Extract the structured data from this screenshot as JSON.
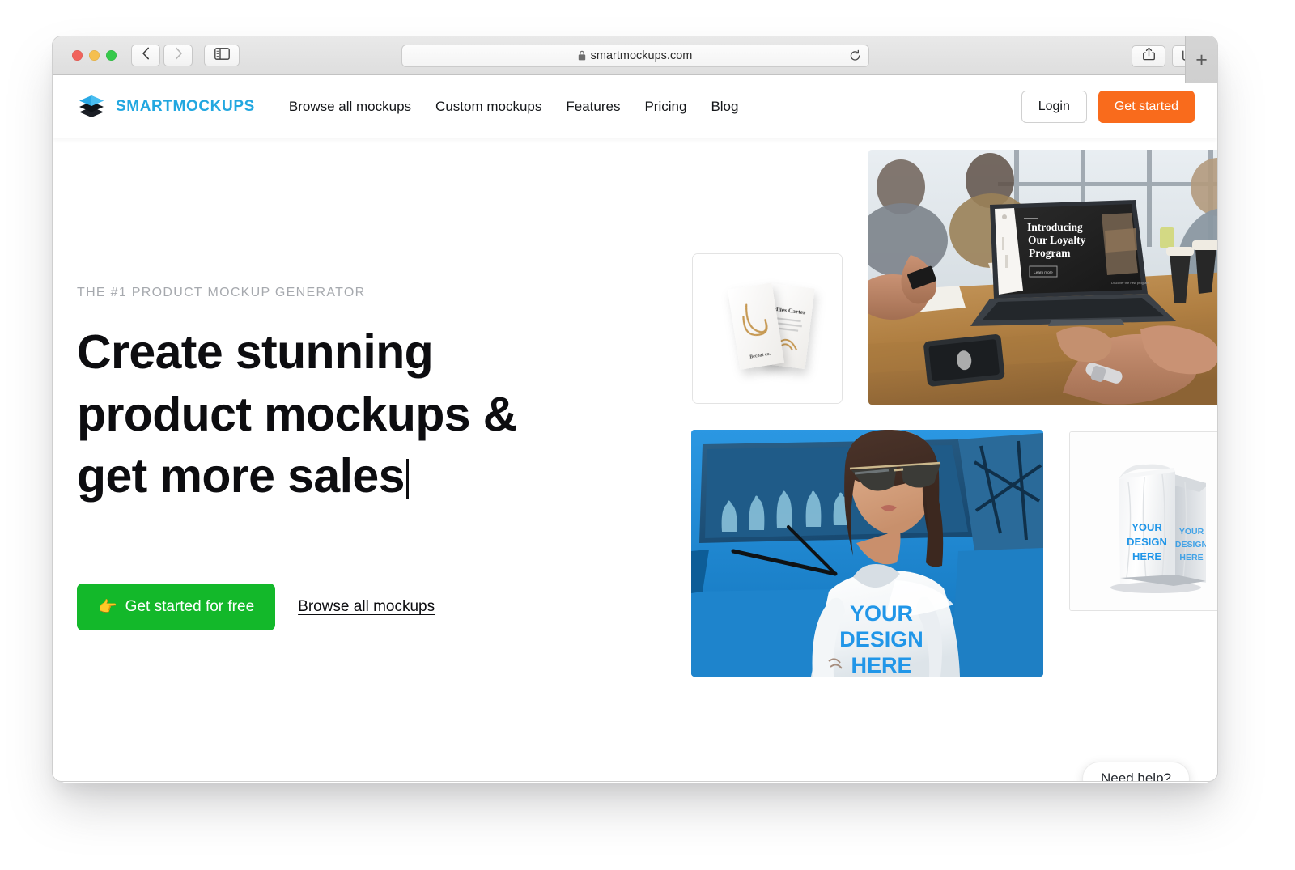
{
  "browser": {
    "url": "smartmockups.com",
    "lock_icon": "lock-icon",
    "reload_icon": "reload-icon",
    "back_icon": "chevron-left-icon",
    "forward_icon": "chevron-right-icon",
    "sidebar_icon": "sidebar-toggle-icon",
    "share_icon": "share-icon",
    "tabs_icon": "show-all-tabs-icon",
    "new_tab_label": "+",
    "traffic_lights": {
      "close": "close-window-button",
      "minimize": "minimize-window-button",
      "zoom": "zoom-window-button"
    }
  },
  "site_header": {
    "logo_text": "SMARTMOCKUPS",
    "logo_icon": "stacked-layers-icon",
    "nav_items": [
      {
        "label": "Browse all mockups"
      },
      {
        "label": "Custom mockups"
      },
      {
        "label": "Features"
      },
      {
        "label": "Pricing"
      },
      {
        "label": "Blog"
      }
    ],
    "login_label": "Login",
    "get_started_label": "Get started"
  },
  "hero": {
    "eyebrow": "THE #1 PRODUCT MOCKUP GENERATOR",
    "headline_line1": "Create stunning",
    "headline_line2": "product mockups &",
    "headline_line3": "get more sales",
    "primary_cta": "Get started for free",
    "primary_cta_emoji": "👉",
    "secondary_cta": "Browse all mockups"
  },
  "mockups": {
    "business_cards": {
      "name": "business-cards-mockup",
      "card_title": "Miles Carter",
      "card_footer": "Becoat co."
    },
    "laptop_meeting": {
      "name": "laptop-meeting-mockup",
      "screen_line1": "Introducing",
      "screen_line2": "Our Loyalty",
      "screen_line3": "Program",
      "screen_button": "Learn more"
    },
    "tshirt": {
      "name": "tshirt-mockup",
      "design_line1": "YOUR",
      "design_line2": "DESIGN",
      "design_line3": "HERE"
    },
    "package": {
      "name": "package-bag-mockup",
      "design_line1": "YOUR",
      "design_line2": "DESIGN",
      "design_line3": "HERE"
    }
  },
  "support": {
    "need_help_label": "Need help?"
  },
  "colors": {
    "brand_blue": "#22a7e0",
    "cta_orange": "#f96b1c",
    "cta_green": "#13b82a",
    "design_blue": "#2196e8",
    "text_dark": "#0d0d10",
    "eyebrow_gray": "#a6a9ae"
  }
}
